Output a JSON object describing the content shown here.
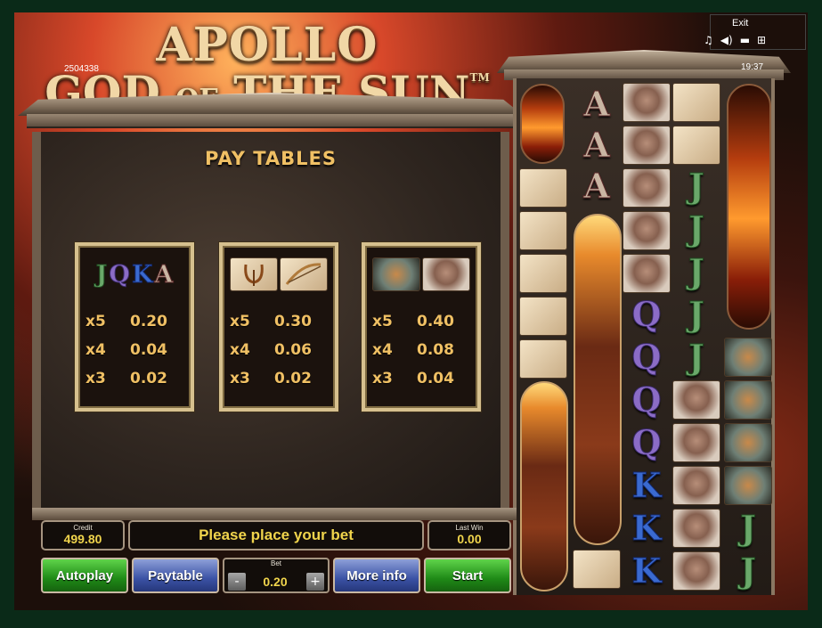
{
  "title": {
    "line1": "APOLLO",
    "line2_a": "GOD",
    "line2_of": "OF",
    "line2_the": "THE",
    "line2_b": "SUN",
    "trademark": "TM"
  },
  "session_id": "2504338",
  "clock": "19:37",
  "exit_label": "Exit",
  "top_icons": [
    "music-icon",
    "speaker-icon",
    "quality-icon",
    "fullscreen-icon"
  ],
  "paytable": {
    "heading": "PAY TABLES",
    "cards": [
      {
        "symbols": [
          "J",
          "Q",
          "K",
          "A"
        ],
        "rows": [
          {
            "mult": "x5",
            "val": "0.20"
          },
          {
            "mult": "x4",
            "val": "0.04"
          },
          {
            "mult": "x3",
            "val": "0.02"
          }
        ]
      },
      {
        "symbols": [
          "lyre",
          "bow"
        ],
        "rows": [
          {
            "mult": "x5",
            "val": "0.30"
          },
          {
            "mult": "x4",
            "val": "0.06"
          },
          {
            "mult": "x3",
            "val": "0.02"
          }
        ]
      },
      {
        "symbols": [
          "chariot",
          "head"
        ],
        "rows": [
          {
            "mult": "x5",
            "val": "0.40"
          },
          {
            "mult": "x4",
            "val": "0.08"
          },
          {
            "mult": "x3",
            "val": "0.04"
          }
        ]
      }
    ]
  },
  "reel_letters": {
    "A": "A",
    "Q": "Q",
    "K": "K",
    "J": "J"
  },
  "status": {
    "credit_label": "Credit",
    "credit_value": "499.80",
    "message": "Please place your bet",
    "lastwin_label": "Last Win",
    "lastwin_value": "0.00"
  },
  "controls": {
    "autoplay": "Autoplay",
    "paytable": "Paytable",
    "bet_label": "Bet",
    "bet_value": "0.20",
    "minus": "-",
    "plus": "+",
    "more_info": "More info",
    "start": "Start"
  },
  "colors": {
    "gold_text": "#f0c064",
    "bet_text": "#f0d44c",
    "green_button": "#2fa82a",
    "blue_button": "#3b52a5"
  }
}
